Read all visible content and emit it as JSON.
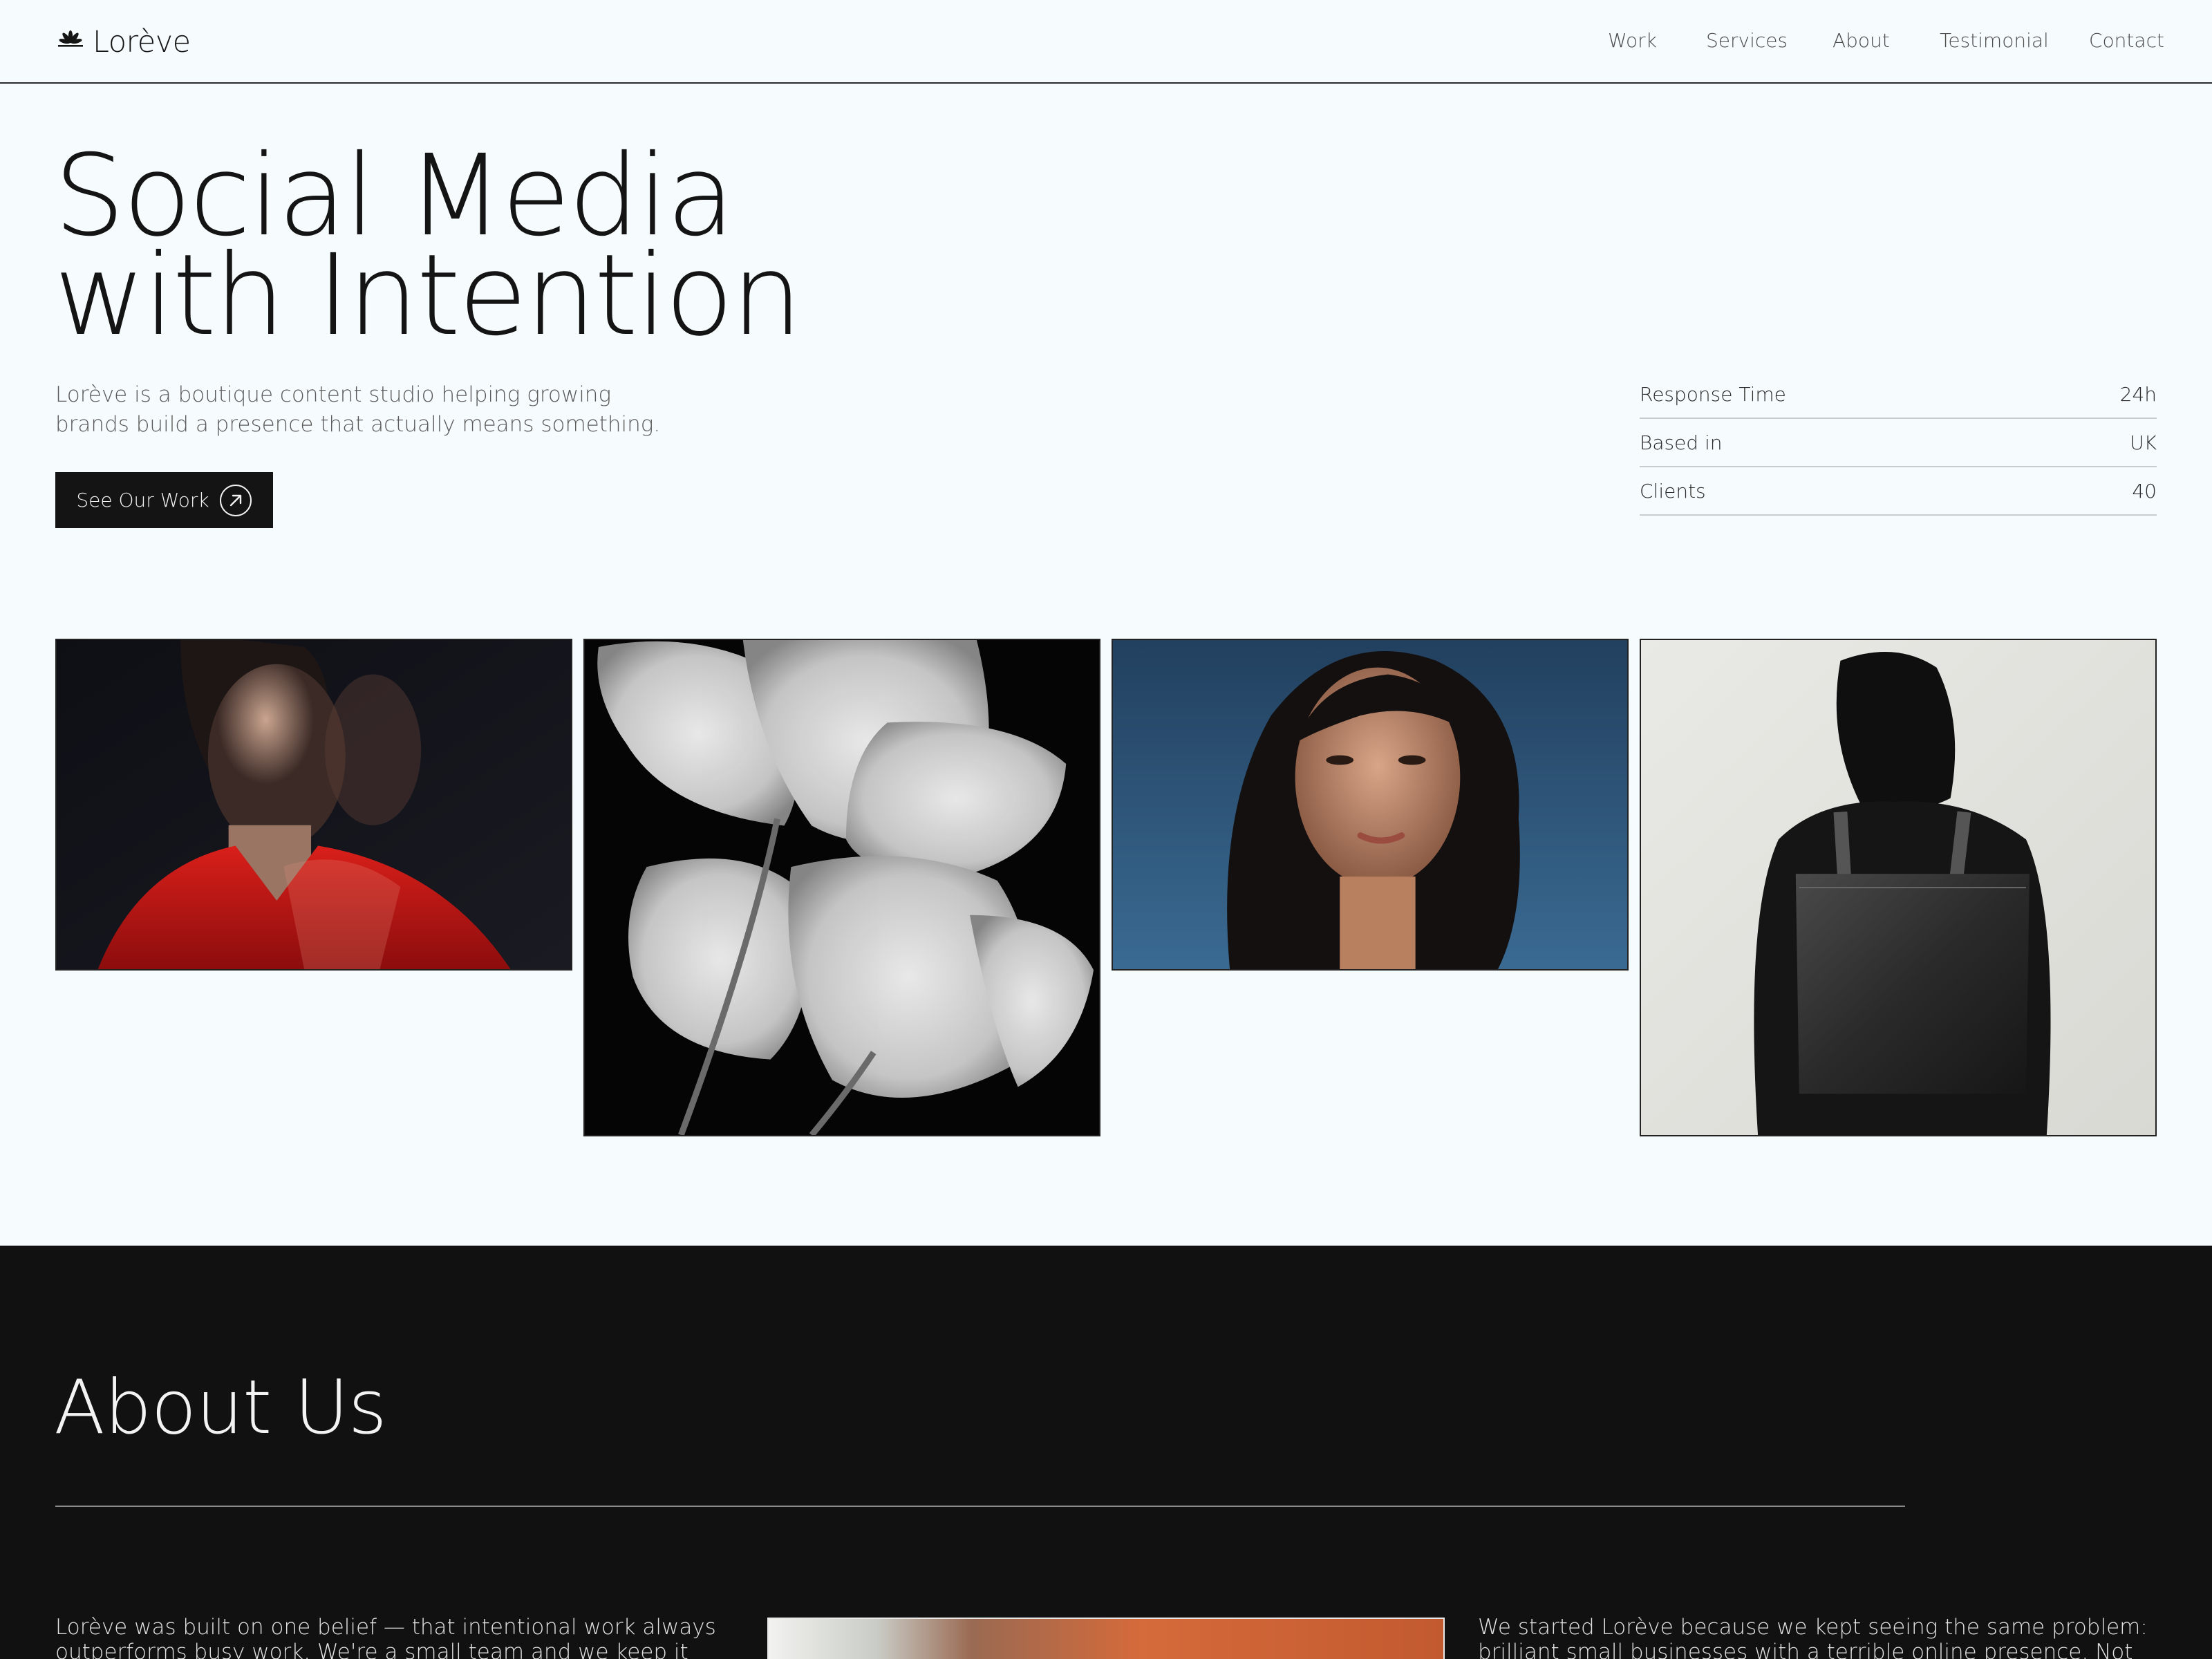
{
  "brand": {
    "name": "Lorève"
  },
  "nav": {
    "items": [
      {
        "label": "Work"
      },
      {
        "label": "Services"
      },
      {
        "label": "About"
      },
      {
        "label": "Testimonial"
      },
      {
        "label": "Contact"
      }
    ]
  },
  "hero": {
    "title_line1": "Social Media",
    "title_line2": "with Intention",
    "description_line1": "Lorève is a boutique content studio helping growing",
    "description_line2": "brands build a presence that actually means something.",
    "cta_label": "See Our Work",
    "cta_icon": "arrow-up-right-icon"
  },
  "stats": [
    {
      "label": "Response Time",
      "value": "24h"
    },
    {
      "label": "Based in",
      "value": "UK"
    },
    {
      "label": "Clients",
      "value": "40"
    }
  ],
  "gallery": [
    {
      "subject": "woman in red shirt, motion blur, dark background"
    },
    {
      "subject": "two translucent white poppy flowers on black"
    },
    {
      "subject": "woman with dark hair against blue sky"
    },
    {
      "subject": "person from behind carrying black leather tote bag"
    }
  ],
  "about": {
    "title": "About Us",
    "left_line1": "Lorève was built on one belief — that intentional work always",
    "left_line2": "outperforms busy work. We're a small team and we keep it that way.",
    "right_line1": "We started Lorève because we kept seeing the same problem:",
    "right_line2": "brilliant small businesses with a terrible online presence. Not because"
  },
  "colors": {
    "background": "#f6fbfd",
    "text": "#141414",
    "dark_section": "#111111",
    "button": "#141414"
  }
}
